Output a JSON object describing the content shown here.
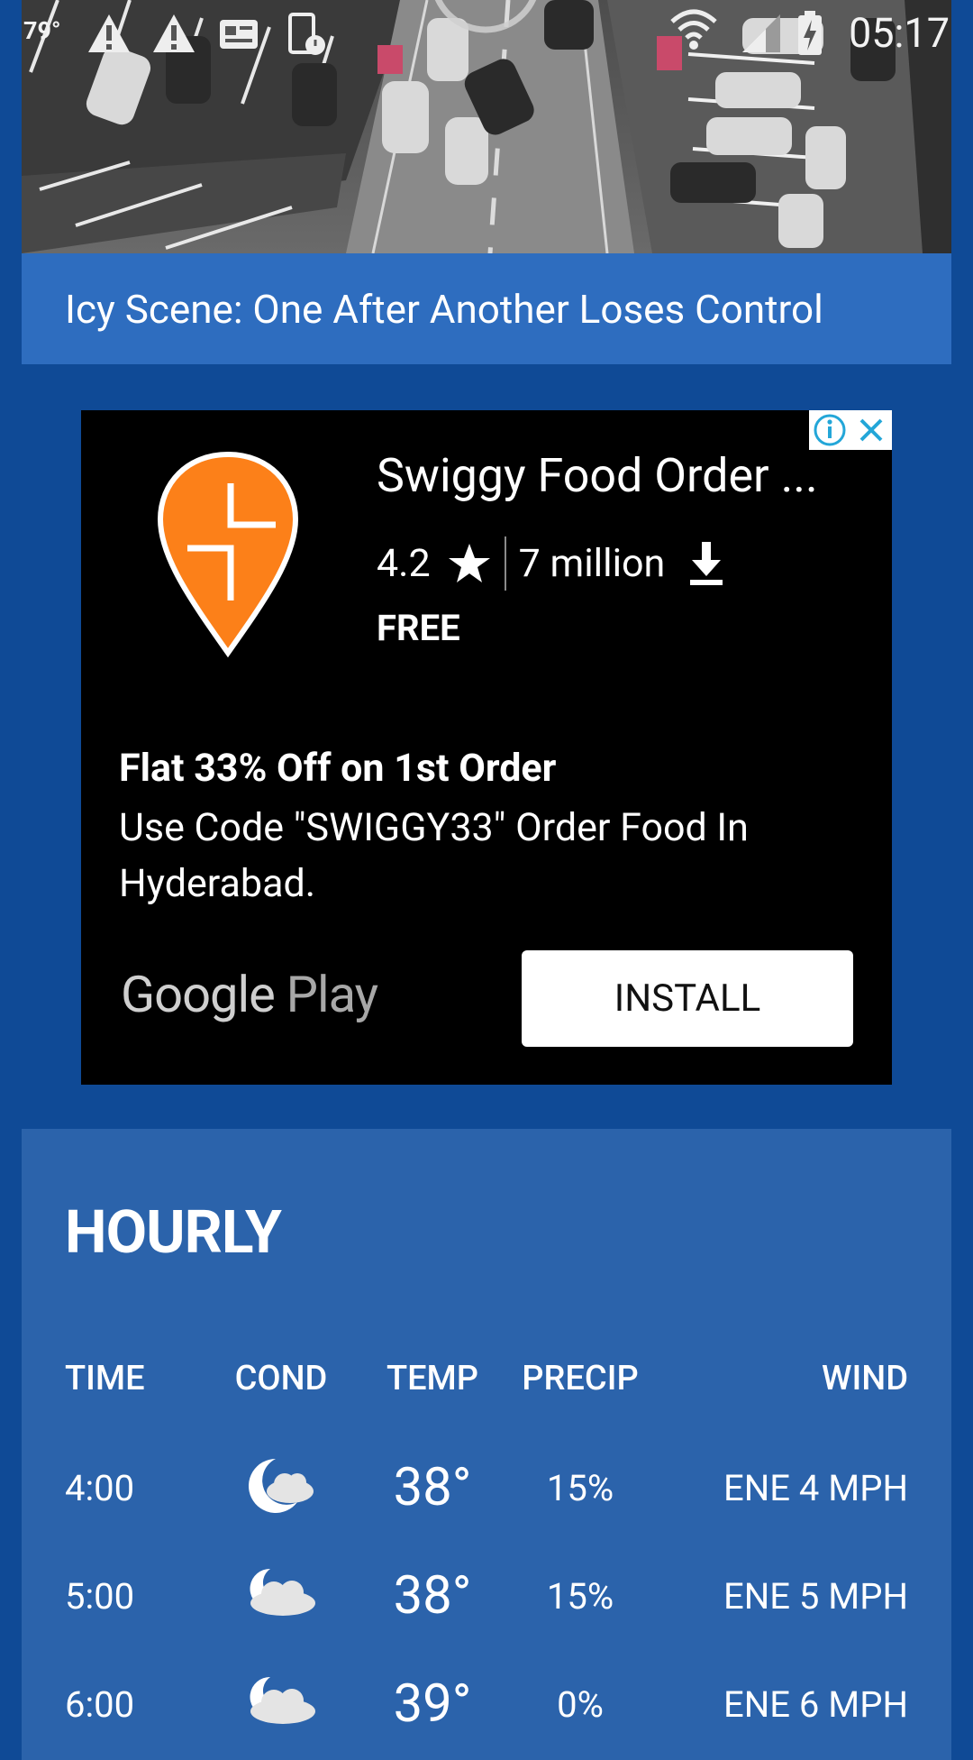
{
  "status_bar": {
    "temperature": "79°",
    "time": "05:17",
    "icons": [
      "warning-icon",
      "warning-icon",
      "news-card-icon",
      "screen-timer-icon",
      "wifi-icon",
      "signal-icon",
      "battery-charging-icon"
    ]
  },
  "video": {
    "caption": "Icy Scene: One After Another Loses Control",
    "play_icon": "play-icon"
  },
  "ad": {
    "app_name": "Swiggy Food Order ...",
    "rating": "4.2",
    "downloads": "7 million",
    "price": "FREE",
    "headline": "Flat 33% Off on 1st Order",
    "body": "Use Code \"SWIGGY33\" Order Food In Hyderabad.",
    "store_google": "Google",
    "store_play": "Play",
    "install_label": "INSTALL",
    "colors": {
      "logo": "#fc8019",
      "background": "#000000"
    }
  },
  "hourly": {
    "title": "HOURLY",
    "columns": {
      "time": "TIME",
      "cond": "COND",
      "temp": "TEMP",
      "precip": "PRECIP",
      "wind": "WIND"
    },
    "rows": [
      {
        "time": "4:00",
        "cond_icon": "partly-cloudy-night-icon",
        "temp": "38°",
        "precip": "15%",
        "wind": "ENE 4 MPH"
      },
      {
        "time": "5:00",
        "cond_icon": "mostly-cloudy-night-icon",
        "temp": "38°",
        "precip": "15%",
        "wind": "ENE 5 MPH"
      },
      {
        "time": "6:00",
        "cond_icon": "mostly-cloudy-night-icon",
        "temp": "39°",
        "precip": "0%",
        "wind": "ENE 6 MPH"
      }
    ]
  },
  "colors": {
    "page_background": "#0f4a96",
    "card_background": "#2b63ab",
    "caption_background": "#2e6dbf"
  }
}
